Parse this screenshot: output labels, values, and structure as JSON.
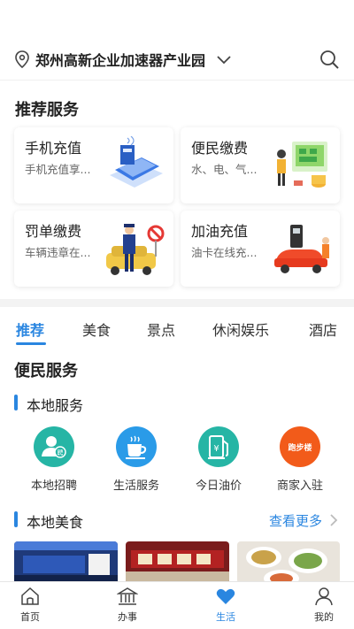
{
  "header": {
    "location": "郑州高新企业加速器产业园"
  },
  "recommend": {
    "title": "推荐服务",
    "cards": [
      {
        "title": "手机充值",
        "subtitle": "手机充值享..."
      },
      {
        "title": "便民缴费",
        "subtitle": "水、电、气..."
      },
      {
        "title": "罚单缴费",
        "subtitle": "车辆违章在..."
      },
      {
        "title": "加油充值",
        "subtitle": "油卡在线充..."
      }
    ]
  },
  "tabs": [
    "推荐",
    "美食",
    "景点",
    "休闲娱乐",
    "酒店"
  ],
  "convenience": {
    "title": "便民服务",
    "local_services_title": "本地服务",
    "services": [
      {
        "label": "本地招聘",
        "icon_text": "聘",
        "color": "#26b5a5"
      },
      {
        "label": "生活服务",
        "color": "#2a9be8"
      },
      {
        "label": "今日油价",
        "icon_text": "¥",
        "color": "#26b5a5"
      },
      {
        "label": "商家入驻",
        "icon_text": "跑步楼",
        "color": "#f25b1a"
      }
    ]
  },
  "food": {
    "title": "本地美食",
    "more": "查看更多"
  },
  "bottom_nav": [
    {
      "label": "首页"
    },
    {
      "label": "办事"
    },
    {
      "label": "生活"
    },
    {
      "label": "我的"
    }
  ],
  "colors": {
    "accent": "#2a86e0"
  }
}
